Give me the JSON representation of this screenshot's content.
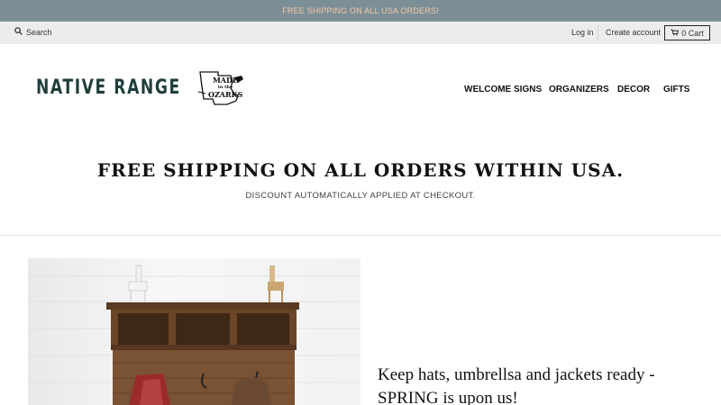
{
  "announcement": {
    "text": "FREE SHIPPING ON ALL USA ORDERS!"
  },
  "topbar": {
    "search_label": "Search",
    "login_label": "Log in",
    "create_account_label": "Create account",
    "cart_label": "0 Cart"
  },
  "header": {
    "brand": "NATIVE RANGE",
    "badge_text": [
      "MADE",
      "in the",
      "OZARKS"
    ],
    "nav": [
      "WELCOME SIGNS",
      "ORGANIZERS",
      "DECOR",
      "GIFTS"
    ]
  },
  "promo": {
    "title": "FREE SHIPPING ON ALL ORDERS WITHIN USA.",
    "subtitle": "DISCOUNT AUTOMATICALLY APPLIED AT CHECKOUT."
  },
  "feature": {
    "text_line1": "Keep hats, umbrellsa and jackets ready -",
    "text_line2": "SPRING is upon us!"
  },
  "colors": {
    "announcement_bg": "#7d8f96",
    "announcement_text": "#f3c7a8",
    "topbar_bg": "#ececec",
    "brand": "#1f3d3a"
  },
  "icons": {
    "search": "search-icon",
    "cart": "cart-icon",
    "badge": "state-map-badge"
  }
}
